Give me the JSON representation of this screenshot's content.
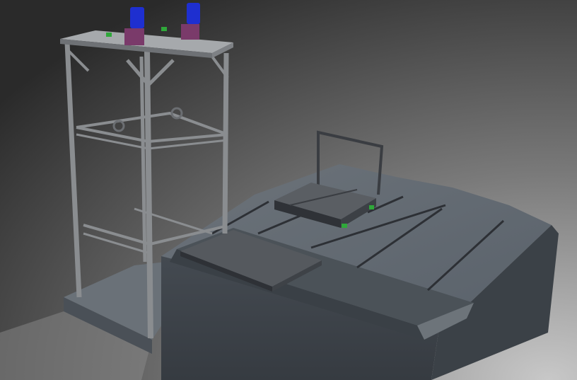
{
  "scene": {
    "colors": {
      "background_top": "#2c2c2c",
      "background_bottom": "#b8b8b8",
      "concrete": "#5d646b",
      "concrete_dark": "#3f454b",
      "steel": "#8a8d90",
      "motor_blue": "#1e2fd0",
      "gearbox_purple": "#7a3a6a",
      "sensor_green": "#2fa83a"
    }
  }
}
